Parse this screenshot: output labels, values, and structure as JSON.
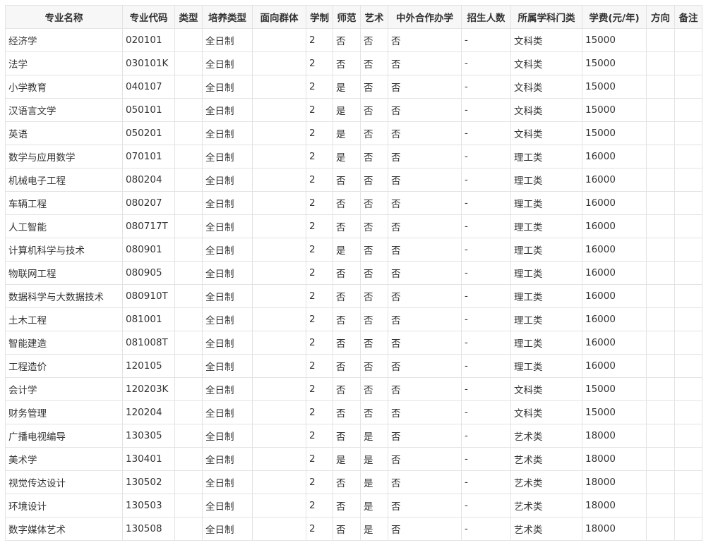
{
  "headers": [
    "专业名称",
    "专业代码",
    "类型",
    "培养类型",
    "面向群体",
    "学制",
    "师范",
    "艺术",
    "中外合作办学",
    "招生人数",
    "所属学科门类",
    "学费(元/年)",
    "方向",
    "备注"
  ],
  "rows": [
    [
      "经济学",
      "020101",
      "",
      "全日制",
      "",
      "2",
      "否",
      "否",
      "否",
      "-",
      "文科类",
      "15000",
      "",
      ""
    ],
    [
      "法学",
      "030101K",
      "",
      "全日制",
      "",
      "2",
      "否",
      "否",
      "否",
      "-",
      "文科类",
      "15000",
      "",
      ""
    ],
    [
      "小学教育",
      "040107",
      "",
      "全日制",
      "",
      "2",
      "是",
      "否",
      "否",
      "-",
      "文科类",
      "15000",
      "",
      ""
    ],
    [
      "汉语言文学",
      "050101",
      "",
      "全日制",
      "",
      "2",
      "是",
      "否",
      "否",
      "-",
      "文科类",
      "15000",
      "",
      ""
    ],
    [
      "英语",
      "050201",
      "",
      "全日制",
      "",
      "2",
      "是",
      "否",
      "否",
      "-",
      "文科类",
      "15000",
      "",
      ""
    ],
    [
      "数学与应用数学",
      "070101",
      "",
      "全日制",
      "",
      "2",
      "是",
      "否",
      "否",
      "-",
      "理工类",
      "16000",
      "",
      ""
    ],
    [
      "机械电子工程",
      "080204",
      "",
      "全日制",
      "",
      "2",
      "否",
      "否",
      "否",
      "-",
      "理工类",
      "16000",
      "",
      ""
    ],
    [
      "车辆工程",
      "080207",
      "",
      "全日制",
      "",
      "2",
      "否",
      "否",
      "否",
      "-",
      "理工类",
      "16000",
      "",
      ""
    ],
    [
      "人工智能",
      "080717T",
      "",
      "全日制",
      "",
      "2",
      "否",
      "否",
      "否",
      "-",
      "理工类",
      "16000",
      "",
      ""
    ],
    [
      "计算机科学与技术",
      "080901",
      "",
      "全日制",
      "",
      "2",
      "是",
      "否",
      "否",
      "-",
      "理工类",
      "16000",
      "",
      ""
    ],
    [
      "物联网工程",
      "080905",
      "",
      "全日制",
      "",
      "2",
      "否",
      "否",
      "否",
      "-",
      "理工类",
      "16000",
      "",
      ""
    ],
    [
      "数据科学与大数据技术",
      "080910T",
      "",
      "全日制",
      "",
      "2",
      "否",
      "否",
      "否",
      "-",
      "理工类",
      "16000",
      "",
      ""
    ],
    [
      "土木工程",
      "081001",
      "",
      "全日制",
      "",
      "2",
      "否",
      "否",
      "否",
      "-",
      "理工类",
      "16000",
      "",
      ""
    ],
    [
      "智能建造",
      "081008T",
      "",
      "全日制",
      "",
      "2",
      "否",
      "否",
      "否",
      "-",
      "理工类",
      "16000",
      "",
      ""
    ],
    [
      "工程造价",
      "120105",
      "",
      "全日制",
      "",
      "2",
      "否",
      "否",
      "否",
      "-",
      "理工类",
      "16000",
      "",
      ""
    ],
    [
      "会计学",
      "120203K",
      "",
      "全日制",
      "",
      "2",
      "否",
      "否",
      "否",
      "-",
      "文科类",
      "15000",
      "",
      ""
    ],
    [
      "财务管理",
      "120204",
      "",
      "全日制",
      "",
      "2",
      "否",
      "否",
      "否",
      "-",
      "文科类",
      "15000",
      "",
      ""
    ],
    [
      "广播电视编导",
      "130305",
      "",
      "全日制",
      "",
      "2",
      "否",
      "是",
      "否",
      "-",
      "艺术类",
      "18000",
      "",
      ""
    ],
    [
      "美术学",
      "130401",
      "",
      "全日制",
      "",
      "2",
      "是",
      "是",
      "否",
      "-",
      "艺术类",
      "18000",
      "",
      ""
    ],
    [
      "视觉传达设计",
      "130502",
      "",
      "全日制",
      "",
      "2",
      "否",
      "是",
      "否",
      "-",
      "艺术类",
      "18000",
      "",
      ""
    ],
    [
      "环境设计",
      "130503",
      "",
      "全日制",
      "",
      "2",
      "否",
      "是",
      "否",
      "-",
      "艺术类",
      "18000",
      "",
      ""
    ],
    [
      "数字媒体艺术",
      "130508",
      "",
      "全日制",
      "",
      "2",
      "否",
      "是",
      "否",
      "-",
      "艺术类",
      "18000",
      "",
      ""
    ]
  ]
}
